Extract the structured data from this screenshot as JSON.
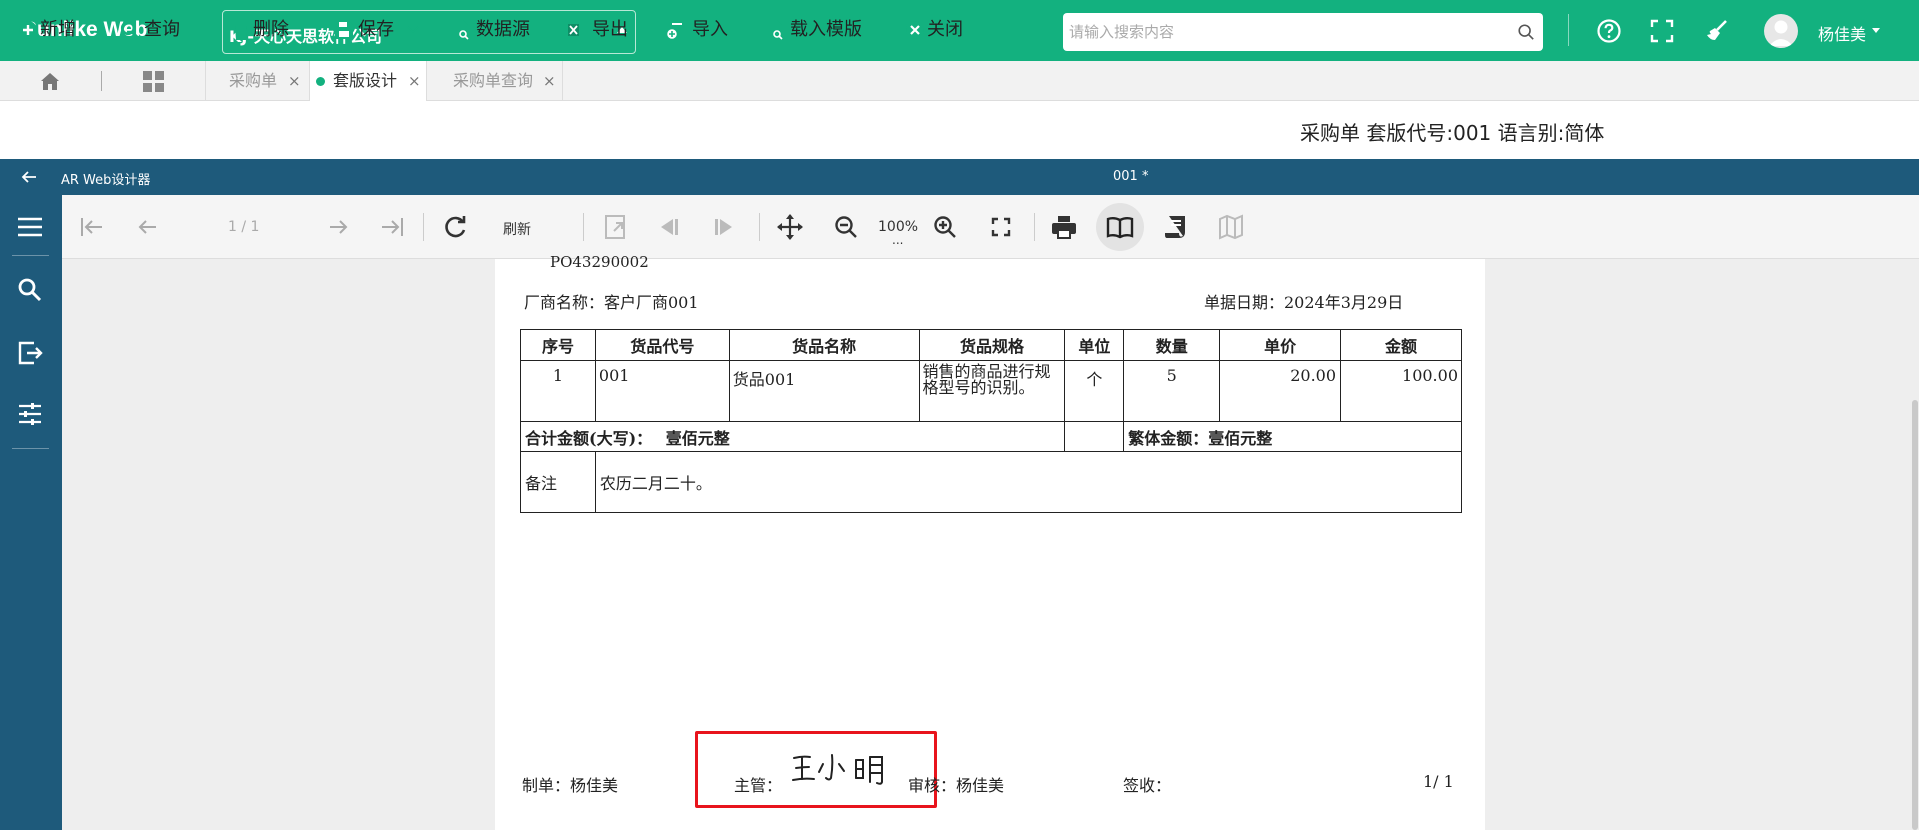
{
  "app": {
    "brand": "Sunlike Web",
    "company": "KJ-天心天思软件公司",
    "search_placeholder": "请输入搜索内容",
    "user_name": "杨佳美"
  },
  "icons": {
    "search": "search-icon",
    "help": "help-circle-icon",
    "fullscreen": "fullscreen-icon",
    "clean": "broom-icon",
    "avatar": "user-avatar-icon",
    "user_caret": "caret-down-icon",
    "home": "home-icon",
    "apps": "apps-grid-icon"
  },
  "colors": {
    "brand_green": "#13b17f",
    "designer_blue": "#1e5a7b",
    "highlight_red": "#e8141c"
  },
  "tabs": [
    {
      "label": "采购单",
      "active": false
    },
    {
      "label": "套版设计",
      "active": true
    },
    {
      "label": "采购单查询",
      "active": false
    }
  ],
  "toolbar": {
    "new": "新增",
    "query": "查询",
    "delete": "删除",
    "save": "保存",
    "datasource": "数据源",
    "export": "导出",
    "import": "导入",
    "load_template": "载入模版",
    "close": "关闭",
    "doc_info": "采购单 套版代号:001 语言别:简体"
  },
  "designer": {
    "title": "AR Web设计器",
    "doc_name": "001 *",
    "page_indicator": "1 / 1",
    "refresh": "刷新",
    "zoom": "100%",
    "zoom_more": "..."
  },
  "paper": {
    "order_no": "PO43290002",
    "vendor_label": "厂商名称：客户厂商001",
    "doc_date_label": "单据日期：2024年3月29日",
    "table": {
      "headers": [
        "序号",
        "货品代号",
        "货品名称",
        "货品规格",
        "单位",
        "数量",
        "单价",
        "金额"
      ],
      "row": {
        "seq": "1",
        "code": "001",
        "name": "货品001",
        "spec": "销售的商品进行规格型号的识别。",
        "unit": "个",
        "qty": "5",
        "price": "20.00",
        "amount": "100.00"
      },
      "total_upper_label": "合计金额(大写)：",
      "total_upper_value": "壹佰元整",
      "total_trad_label": "繁体金额：",
      "total_trad_value": "壹佰元整",
      "remark_label": "备注",
      "remark_value": "农历二月二十。"
    },
    "footer": {
      "maker": "制单：杨佳美",
      "manager_label": "主管：",
      "manager_signature": "王小明",
      "reviewer": "审核：杨佳美",
      "receiver": "签收：",
      "page_no": "1/ 1"
    }
  }
}
